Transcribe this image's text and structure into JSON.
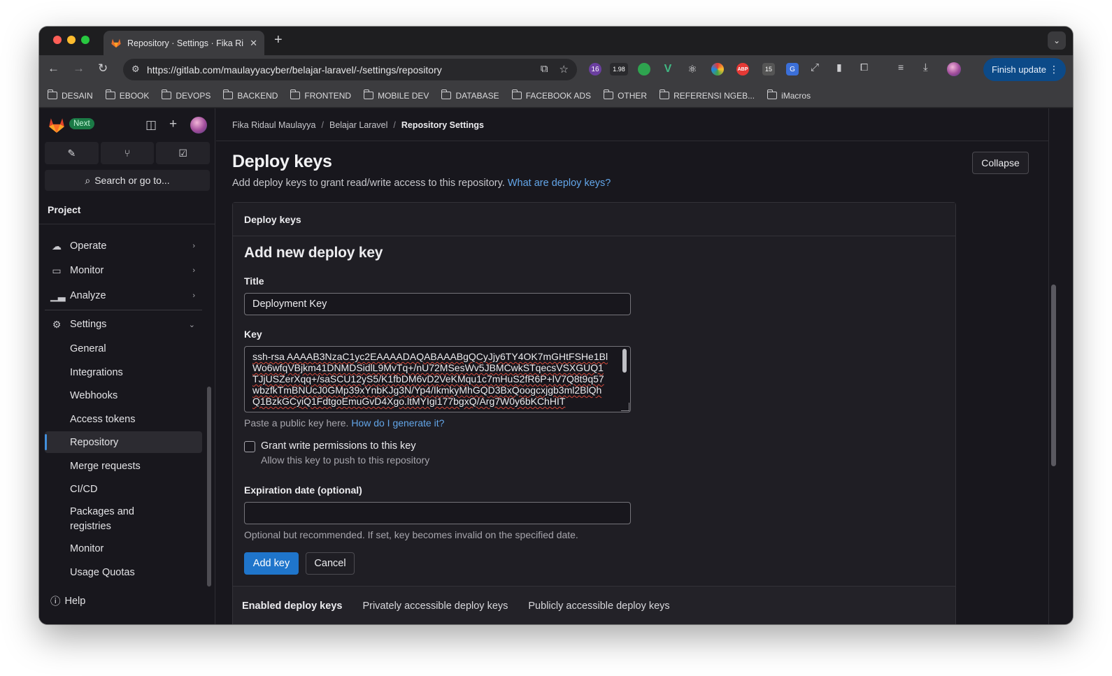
{
  "browser": {
    "tab_title": "Repository · Settings · Fika Ri",
    "url": "https://gitlab.com/maulayyacyber/belajar-laravel/-/settings/repository",
    "finish_update_label": "Finish update",
    "extensions": [
      {
        "name": "extension-badge-16",
        "badge": "16",
        "color": "#6b3fa0"
      },
      {
        "name": "extension-badge-1.98",
        "badge": "1.98",
        "color": "#2a2a2d"
      },
      {
        "name": "extension-green-dot",
        "badge": "",
        "color": "#2ea44f"
      },
      {
        "name": "extension-vue",
        "badge": "",
        "color": "#3c3c3f"
      },
      {
        "name": "extension-react",
        "badge": "",
        "color": "#3c3c3f"
      },
      {
        "name": "extension-colorful-ring",
        "badge": "",
        "color": "#d1335b"
      },
      {
        "name": "extension-abp",
        "badge": "ABP",
        "color": "#e53935"
      },
      {
        "name": "extension-badge-15",
        "badge": "15",
        "color": "#555"
      },
      {
        "name": "extension-translate",
        "badge": "",
        "color": "#3b6fd8"
      }
    ]
  },
  "bookmarks": [
    "DESAIN",
    "EBOOK",
    "DEVOPS",
    "BACKEND",
    "FRONTEND",
    "MOBILE DEV",
    "DATABASE",
    "FACEBOOK ADS",
    "OTHER",
    "REFERENSI NGEB...",
    "iMacros"
  ],
  "sidebar": {
    "badge": "Next",
    "search_label": "Search or go to...",
    "section_title": "Project",
    "groups": [
      {
        "label": "Operate",
        "icon": "operate-icon"
      },
      {
        "label": "Monitor",
        "icon": "monitor-icon"
      },
      {
        "label": "Analyze",
        "icon": "analyze-icon"
      },
      {
        "label": "Settings",
        "icon": "settings-icon"
      }
    ],
    "settings_items": [
      "General",
      "Integrations",
      "Webhooks",
      "Access tokens",
      "Repository",
      "Merge requests",
      "CI/CD",
      "Packages and registries",
      "Monitor",
      "Usage Quotas"
    ],
    "help_label": "Help"
  },
  "breadcrumb": {
    "owner": "Fika Ridaul Maulayya",
    "project": "Belajar Laravel",
    "current": "Repository Settings"
  },
  "section": {
    "title": "Deploy keys",
    "description": "Add deploy keys to grant read/write access to this repository.",
    "description_link": "What are deploy keys?",
    "collapse_label": "Collapse"
  },
  "card": {
    "header": "Deploy keys",
    "form_title": "Add new deploy key",
    "title_label": "Title",
    "title_value": "Deployment Key",
    "key_label": "Key",
    "key_value": "ssh-rsa AAAAB3NzaC1yc2EAAAADAQABAAABgQCyJjy6TY4OK7mGHtFSHe1BlWo6wfqVBjkm41DNMDSidlL9MvTq+/nU72MSesWv5JBMCwkSTqecsVSXGUQ1TJjUSZerXqq+/saSCU12yS5/K1fbDM6vD2VeKMqu1c7mHuS2fR6P+lV7Q8t9q57wbzfkTmBNUcJ0GMp39xYnbKJg3N/Yp4/IkmkyMhGQD3BxQoogcxjgb3ml2BlQhQ1BzkGCyiQ1FdtgoEmuGvD4Xgo.ltMYIgi177bgxQ/Arg7W0y6bKChHIT",
    "key_help": "Paste a public key here.",
    "key_help_link": "How do I generate it?",
    "write_label": "Grant write permissions to this key",
    "write_help": "Allow this key to push to this repository",
    "write_checked": false,
    "expiration_label": "Expiration date (optional)",
    "expiration_value": "",
    "expiration_help": "Optional but recommended. If set, key becomes invalid on the specified date.",
    "add_label": "Add key",
    "cancel_label": "Cancel",
    "tabs": [
      "Enabled deploy keys",
      "Privately accessible deploy keys",
      "Publicly accessible deploy keys"
    ]
  }
}
